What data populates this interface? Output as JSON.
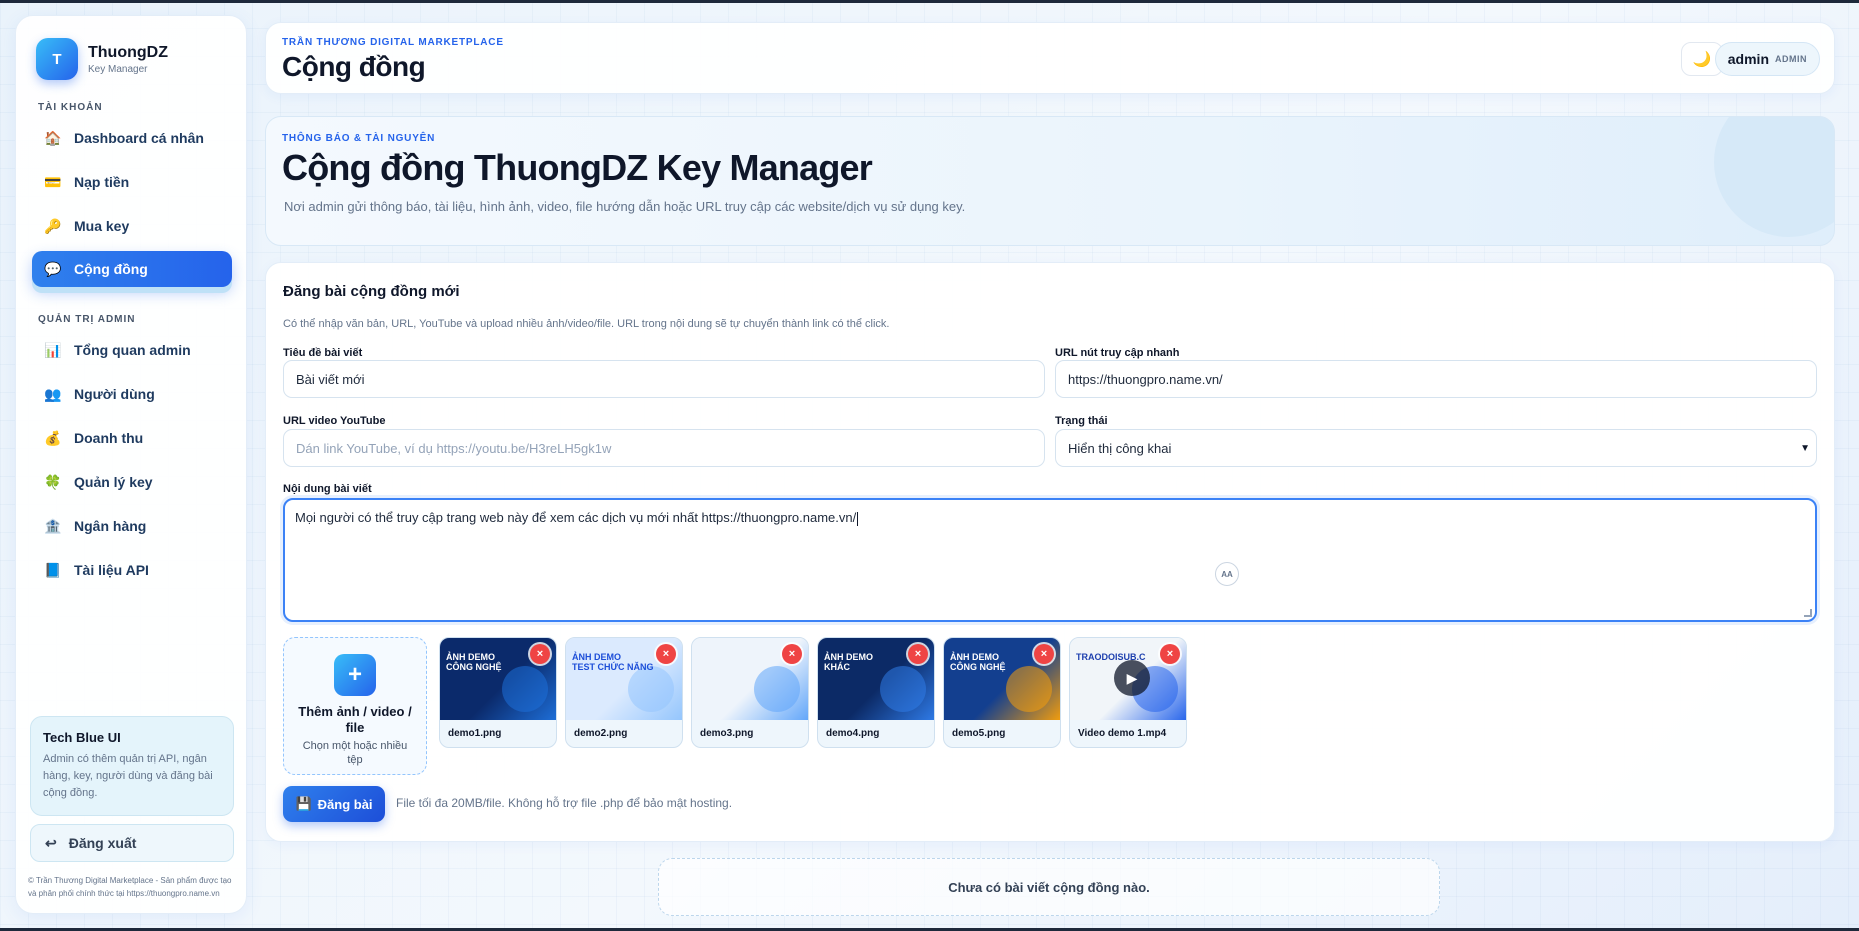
{
  "sidebar": {
    "brand": {
      "logo_letter": "T",
      "name": "ThuongDZ",
      "sub": "Key Manager"
    },
    "section_account": "TÀI KHOẢN",
    "section_admin": "QUẢN TRỊ ADMIN",
    "items": [
      {
        "label": "Dashboard cá nhân",
        "icon": "home-icon",
        "glyph": "🏠"
      },
      {
        "label": "Nạp tiền",
        "icon": "card-icon",
        "glyph": "💳"
      },
      {
        "label": "Mua key",
        "icon": "key-icon",
        "glyph": "🔑"
      },
      {
        "label": "Cộng đồng",
        "icon": "chat-icon",
        "glyph": "💬",
        "active": true
      },
      {
        "label": "Tổng quan admin",
        "icon": "chart-icon",
        "glyph": "📊"
      },
      {
        "label": "Người dùng",
        "icon": "users-icon",
        "glyph": "👥"
      },
      {
        "label": "Doanh thu",
        "icon": "money-bag-icon",
        "glyph": "💰"
      },
      {
        "label": "Quản lý key",
        "icon": "clover-icon",
        "glyph": "🍀"
      },
      {
        "label": "Ngân hàng",
        "icon": "bank-icon",
        "glyph": "🏦"
      },
      {
        "label": "Tài liệu API",
        "icon": "book-icon",
        "glyph": "📘"
      }
    ],
    "tip": {
      "title": "Tech Blue UI",
      "text": "Admin có thêm quản trị API, ngân hàng, key, người dùng và đăng bài cộng đồng."
    },
    "logout": {
      "label": "Đăng xuất",
      "glyph": "↩"
    },
    "copyright": "© Trần Thương Digital Marketplace - Sản phẩm được tạo và phân phối chính thức tại https://thuongpro.name.vn"
  },
  "header": {
    "eyebrow": "TRẦN THƯƠNG DIGITAL MARKETPLACE",
    "title": "Cộng đồng",
    "theme_glyph": "🌙",
    "user": {
      "name": "admin",
      "role": "ADMIN"
    }
  },
  "hero": {
    "eyebrow": "THÔNG BÁO & TÀI NGUYÊN",
    "title": "Cộng đồng ThuongDZ Key Manager",
    "desc": "Nơi admin gửi thông báo, tài liệu, hình ảnh, video, file hướng dẫn hoặc URL truy cập các website/dịch vụ sử dụng key."
  },
  "form": {
    "title": "Đăng bài cộng đồng mới",
    "hint": "Có thể nhập văn bản, URL, YouTube và upload nhiều ảnh/video/file. URL trong nội dung sẽ tự chuyển thành link có thể click.",
    "post_title": {
      "label": "Tiêu đề bài viết",
      "value": "Bài viết mới"
    },
    "quick_url": {
      "label": "URL nút truy cập nhanh",
      "value": "https://thuongpro.name.vn/"
    },
    "youtube": {
      "label": "URL video YouTube",
      "placeholder": "Dán link YouTube, ví dụ https://youtu.be/H3reLH5gk1w"
    },
    "status": {
      "label": "Trạng thái",
      "value": "Hiển thị công khai"
    },
    "content": {
      "label": "Nội dung bài viết",
      "value": "Mọi  người có thể truy cập trang web này để xem các dịch vụ mới nhất https://thuongpro.name.vn/",
      "badge": "AA"
    },
    "add_media": {
      "glyph": "+",
      "title": "Thêm ảnh / video / file",
      "sub": "Chọn một hoặc nhiều tệp"
    },
    "attachments": [
      {
        "name": "demo1.png",
        "caption": "ẢNH DEMO\nCÔNG NGHỆ",
        "bg": "#0b2a6b",
        "fg": "#ffffff",
        "accent": "#1e6fd9"
      },
      {
        "name": "demo2.png",
        "caption": "ẢNH DEMO\nTEST CHỨC NĂNG",
        "bg": "#dbeafe",
        "fg": "#1d4ed8",
        "accent": "#93c5fd"
      },
      {
        "name": "demo3.png",
        "caption": "",
        "bg": "#eef4fb",
        "fg": "#1e3a8a",
        "accent": "#60a5fa"
      },
      {
        "name": "demo4.png",
        "caption": "ẢNH DEMO\nKHÁC",
        "bg": "#0c2a66",
        "fg": "#ffffff",
        "accent": "#2f7be8"
      },
      {
        "name": "demo5.png",
        "caption": "ẢNH DEMO\nCÔNG NGHỆ",
        "bg": "#133f8f",
        "fg": "#ffffff",
        "accent": "#f59e0b"
      },
      {
        "name": "Video demo 1.mp4",
        "caption": "TRAODOISUB.C",
        "bg": "#f1f5f9",
        "fg": "#1e40af",
        "accent": "#2563eb",
        "video": true
      }
    ],
    "remove_glyph": "×",
    "submit": {
      "glyph": "💾",
      "label": "Đăng bài"
    },
    "note": "File tối đa 20MB/file. Không hỗ trợ file .php để bảo mật hosting."
  },
  "empty_state": "Chưa có bài viết cộng đồng nào."
}
